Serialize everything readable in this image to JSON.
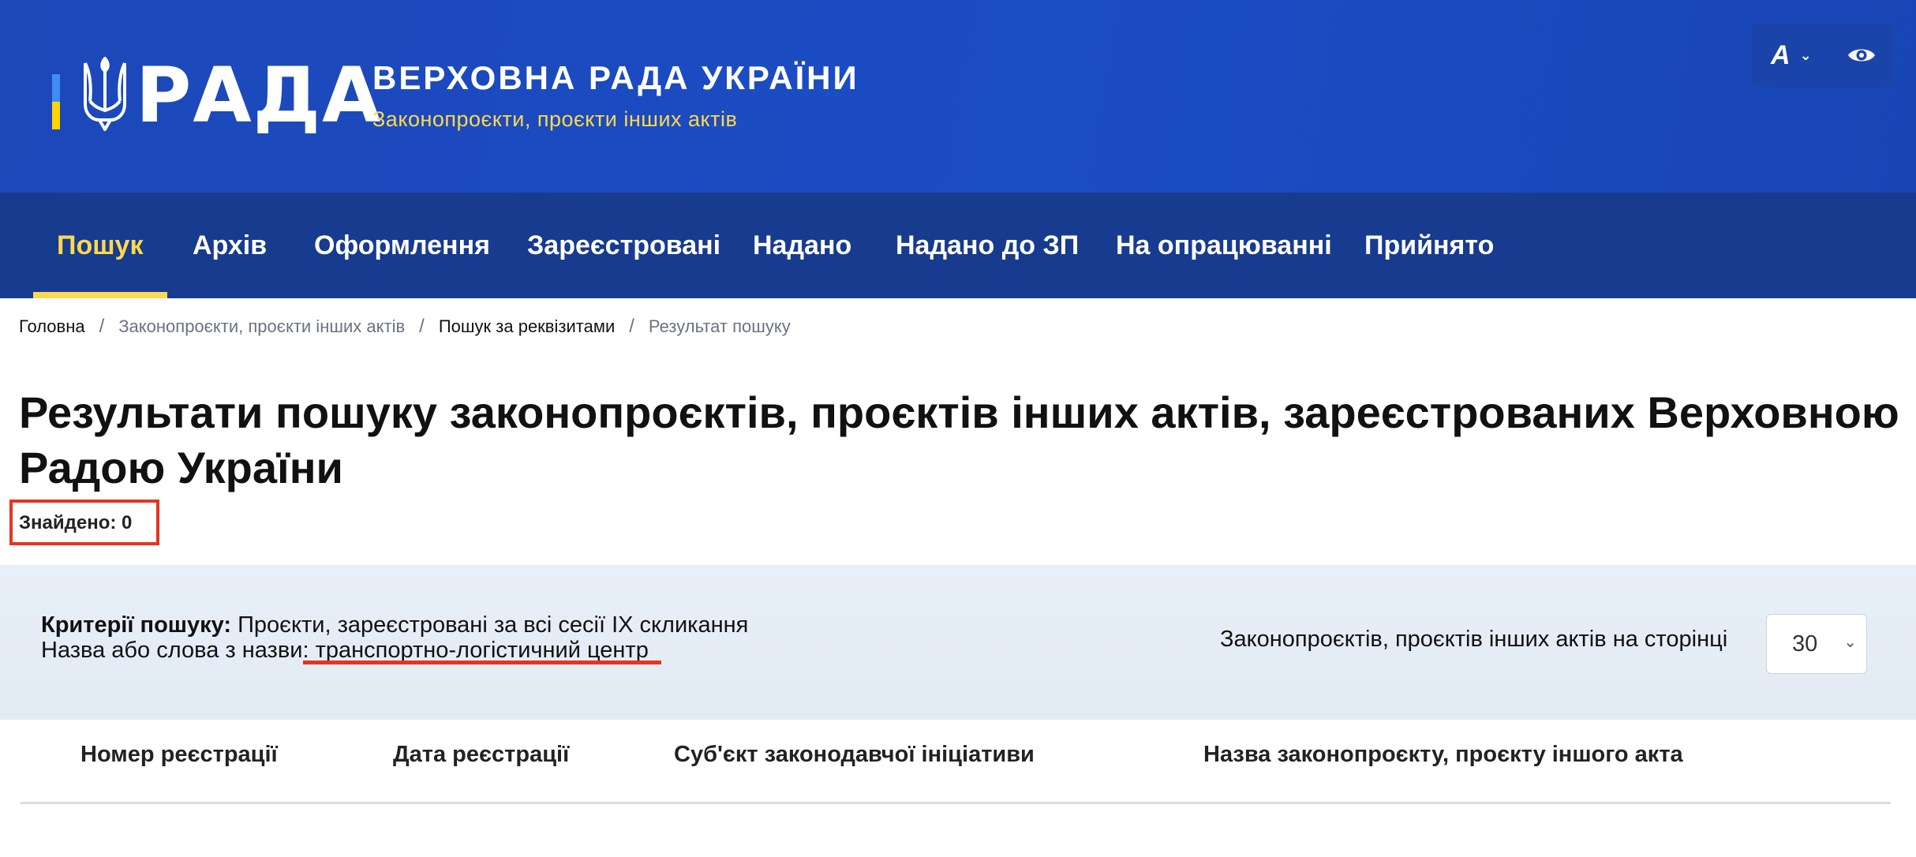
{
  "header": {
    "logo_text": "РАДА",
    "title": "ВЕРХОВНА РАДА УКРАЇНИ",
    "subtitle": "Законопроєкти, проєкти інших актів",
    "font_button_label": "A",
    "icons": [
      "trident-icon",
      "chevron-down-icon",
      "eye-icon"
    ]
  },
  "nav": {
    "items": [
      {
        "label": "Пошук",
        "active": true
      },
      {
        "label": "Архів"
      },
      {
        "label": "Оформлення"
      },
      {
        "label": "Зареєстровані"
      },
      {
        "label": "Надано"
      },
      {
        "label": "Надано до ЗП"
      },
      {
        "label": "На опрацюванні"
      },
      {
        "label": "Прийнято"
      }
    ]
  },
  "breadcrumb": {
    "items": [
      "Головна",
      "Законопроєкти, проєкти інших актів",
      "Пошук за реквізитами",
      "Результат пошуку"
    ],
    "separator": "/"
  },
  "page": {
    "title": "Результати пошуку законопроєктів, проєктів інших актів, зареєстрованих Верховною Радою України",
    "found": "Знайдено: 0"
  },
  "criteria": {
    "label": "Критерії пошуку:",
    "value": "Проєкти, зареєстровані за всі сесії IX скликання",
    "name_label": "Назва або слова з назви:",
    "name_value": "транспортно-логістичний центр",
    "per_page_label": "Законопроєктів, проєктів інших актів на сторінці",
    "per_page_value": "30"
  },
  "table": {
    "columns": [
      "Номер реєстрації",
      "Дата реєстрації",
      "Суб'єкт законодавчої ініціативи",
      "Назва законопроєкту, проєкту іншого акта"
    ]
  },
  "colors": {
    "header_blue": "#1b4dc6",
    "nav_blue": "#173b8f",
    "accent_yellow": "#ffd84d",
    "highlight_red": "#e53520",
    "panel_bg": "#e6edf6"
  }
}
